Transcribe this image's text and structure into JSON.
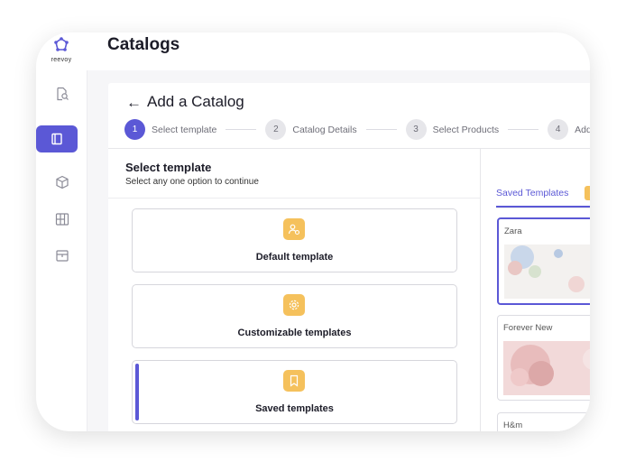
{
  "app": {
    "logo_text": "reevoy",
    "page_title": "Catalogs"
  },
  "colors": {
    "accent": "#5b58d6",
    "icon_bg": "#f5c15c",
    "background": "#f6f6f8"
  },
  "sidebar": {
    "items": [
      {
        "icon": "search-document-icon",
        "active": false
      },
      {
        "icon": "catalog-book-icon",
        "active": true
      },
      {
        "icon": "product-box-icon",
        "active": false
      },
      {
        "icon": "grid-layout-icon",
        "active": false
      },
      {
        "icon": "store-icon",
        "active": false
      }
    ]
  },
  "header": {
    "back_arrow": "←",
    "title": "Add a Catalog"
  },
  "stepper": {
    "steps": [
      {
        "num": "1",
        "label": "Select template",
        "active": true
      },
      {
        "num": "2",
        "label": "Catalog Details",
        "active": false
      },
      {
        "num": "3",
        "label": "Select Products",
        "active": false
      },
      {
        "num": "4",
        "label": "Add Story",
        "active": false
      }
    ]
  },
  "select": {
    "title": "Select template",
    "subtitle": "Select any one option to continue",
    "options": [
      {
        "label": "Default template",
        "icon": "user-settings-icon",
        "selected": false
      },
      {
        "label": "Customizable templates",
        "icon": "gear-icon",
        "selected": false
      },
      {
        "label": "Saved templates",
        "icon": "bookmark-icon",
        "selected": true
      }
    ]
  },
  "saved": {
    "tab_label": "Saved Templates",
    "templates": [
      {
        "name": "Zara",
        "selected": true
      },
      {
        "name": "Forever New",
        "selected": false
      },
      {
        "name": "H&m",
        "selected": false
      }
    ]
  }
}
